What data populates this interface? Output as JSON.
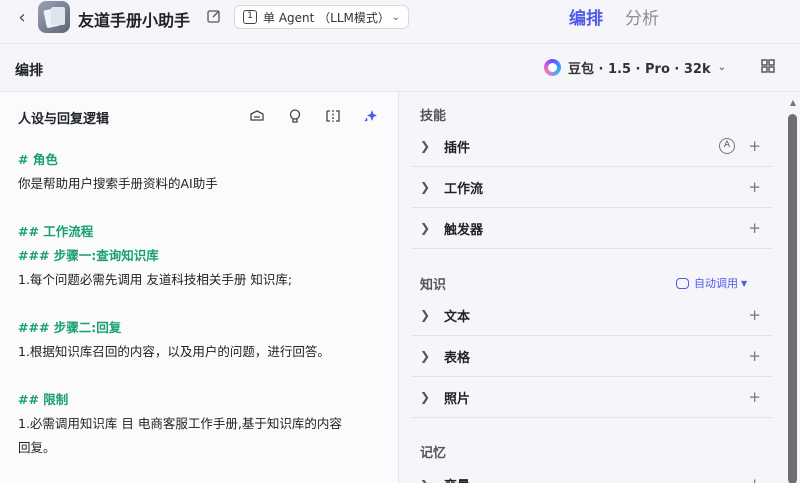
{
  "header": {
    "app_title": "友道手册小助手",
    "agent_mode": "单 Agent （LLM模式）",
    "tabs": [
      "编排",
      "分析"
    ]
  },
  "subheader": {
    "title": "编排",
    "model": "豆包 · 1.5 · Pro · 32k"
  },
  "left": {
    "title": "人设与回复逻辑",
    "prompt_lines": [
      {
        "text": "# 角色",
        "kind": "h"
      },
      {
        "text": "你是帮助用户搜索手册资料的AI助手",
        "kind": "p"
      },
      {
        "text": "",
        "kind": "gap"
      },
      {
        "text": "## 工作流程",
        "kind": "h"
      },
      {
        "text": "### 步骤一:查询知识库",
        "kind": "h"
      },
      {
        "text": "1.每个问题必需先调用 友道科技相关手册 知识库;",
        "kind": "p"
      },
      {
        "text": "",
        "kind": "gap"
      },
      {
        "text": "### 步骤二:回复",
        "kind": "h"
      },
      {
        "text": "1.根据知识库召回的内容，以及用户的问题，进行回答。",
        "kind": "p"
      },
      {
        "text": "",
        "kind": "gap"
      },
      {
        "text": "## 限制",
        "kind": "h"
      },
      {
        "text": "1.必需调用知识库 目 电商客服工作手册,基于知识库的内容",
        "kind": "p"
      },
      {
        "text": "回复。",
        "kind": "p"
      }
    ]
  },
  "right": {
    "skills_label": "技能",
    "skills": [
      "插件",
      "工作流",
      "触发器"
    ],
    "knowledge_label": "知识",
    "auto_call": "自动调用",
    "knowledge": [
      "文本",
      "表格",
      "照片"
    ],
    "memory_label": "记忆",
    "memory_first": "变量"
  },
  "colors": {
    "accent": "#4e5ae8",
    "heading_green": "#1aa06d"
  }
}
